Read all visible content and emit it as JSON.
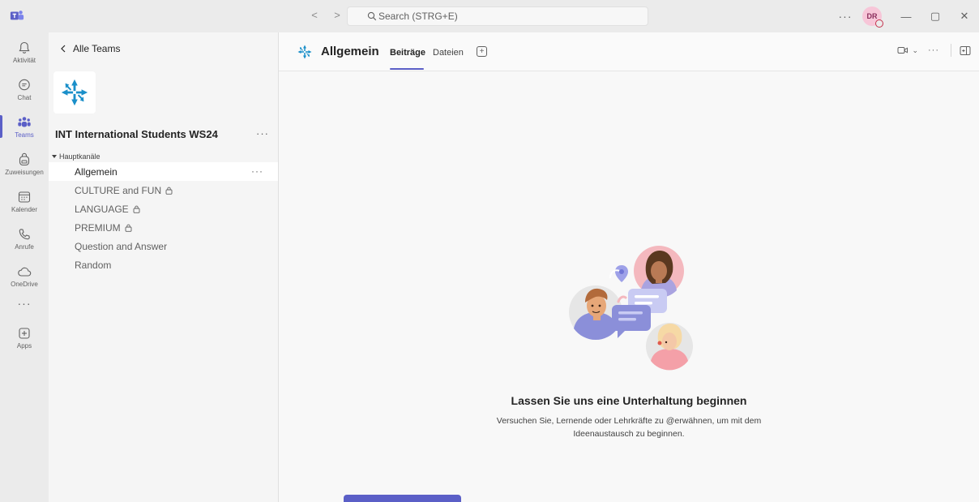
{
  "titlebar": {
    "back_glyph": "<",
    "forward_glyph": ">",
    "search_placeholder": "Search (STRG+E)",
    "more_glyph": "···",
    "avatar_initials": "DR",
    "minimize_glyph": "—",
    "restore_glyph": "▢",
    "close_glyph": "✕"
  },
  "rail": {
    "items": [
      {
        "label": "Aktivität",
        "icon": "bell-icon"
      },
      {
        "label": "Chat",
        "icon": "chat-icon"
      },
      {
        "label": "Teams",
        "icon": "teams-icon",
        "active": true
      },
      {
        "label": "Zuweisungen",
        "icon": "backpack-icon"
      },
      {
        "label": "Kalender",
        "icon": "calendar-icon"
      },
      {
        "label": "Anrufe",
        "icon": "phone-icon"
      },
      {
        "label": "OneDrive",
        "icon": "cloud-icon"
      }
    ],
    "more_glyph": "···",
    "apps_label": "Apps"
  },
  "panel": {
    "back_label": "Alle Teams",
    "team_name": "INT International Students WS24",
    "team_more": "···",
    "section_label": "Hauptkanäle",
    "channels": [
      {
        "name": "Allgemein",
        "selected": true,
        "locked": false
      },
      {
        "name": "CULTURE and FUN",
        "selected": false,
        "locked": true
      },
      {
        "name": "LANGUAGE",
        "selected": false,
        "locked": true
      },
      {
        "name": "PREMIUM",
        "selected": false,
        "locked": true
      },
      {
        "name": "Question and Answer",
        "selected": false,
        "locked": false
      },
      {
        "name": "Random",
        "selected": false,
        "locked": false
      }
    ],
    "channel_more": "···"
  },
  "main": {
    "channel_title": "Allgemein",
    "tabs": [
      "Beiträge",
      "Dateien"
    ],
    "active_tab": "Beiträge",
    "add_tab_glyph": "+",
    "more_glyph": "···",
    "empty_title": "Lassen Sie uns eine Unterhaltung beginnen",
    "empty_subtitle": "Versuchen Sie, Lernende oder Lehrkräfte zu @erwähnen, um mit dem Ideenaustausch zu beginnen."
  },
  "colors": {
    "accent": "#5b5fc7",
    "team_logo": "#1a8fc9"
  }
}
